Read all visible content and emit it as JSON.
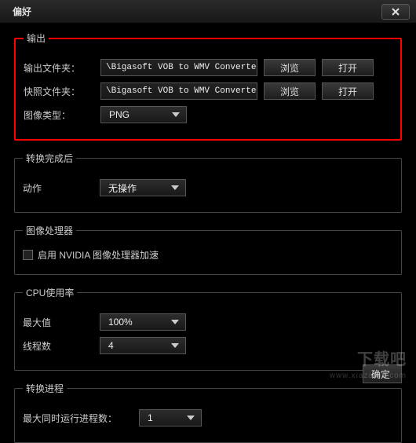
{
  "window": {
    "title": "偏好"
  },
  "output": {
    "legend": "输出",
    "folder_label": "输出文件夹：",
    "folder_value": "\\Bigasoft VOB to WMV Converter",
    "snapshot_label": "快照文件夹：",
    "snapshot_value": "\\Bigasoft VOB to WMV Converter",
    "image_type_label": "图像类型：",
    "image_type_value": "PNG",
    "browse": "浏览",
    "open": "打开"
  },
  "after_convert": {
    "legend": "转换完成后",
    "action_label": "动作",
    "action_value": "无操作"
  },
  "gpu": {
    "legend": "图像处理器",
    "checkbox_label": "启用 NVIDIA 图像处理器加速"
  },
  "cpu": {
    "legend": "CPU使用率",
    "max_label": "最大值",
    "max_value": "100%",
    "threads_label": "线程数",
    "threads_value": "4"
  },
  "progress": {
    "legend": "转换进程",
    "max_concurrent_label": "最大同时运行进程数：",
    "max_concurrent_value": "1"
  },
  "buttons": {
    "ok": "确定"
  },
  "watermark": {
    "main": "下载吧",
    "sub": "www.xiazaiba.com"
  }
}
